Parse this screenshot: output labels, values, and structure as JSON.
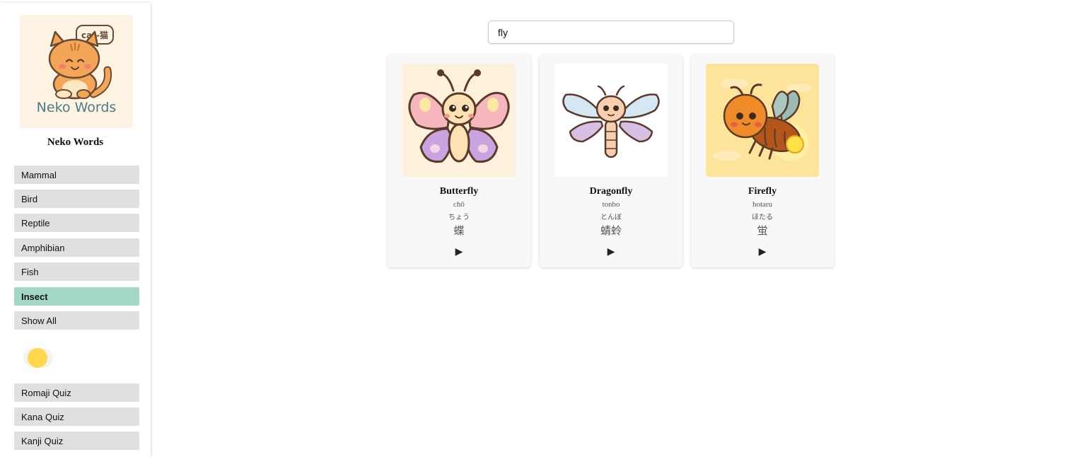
{
  "sidebar": {
    "logo": {
      "bubble_text": "cat-猫",
      "wordmark": "Neko Words",
      "icon": "cat-logo-icon"
    },
    "brand_title": "Neko Words",
    "categories": [
      {
        "label": "Mammal",
        "active": false
      },
      {
        "label": "Bird",
        "active": false
      },
      {
        "label": "Reptile",
        "active": false
      },
      {
        "label": "Amphibian",
        "active": false
      },
      {
        "label": "Fish",
        "active": false
      },
      {
        "label": "Insect",
        "active": true
      },
      {
        "label": "Show All",
        "active": false
      }
    ],
    "theme_toggle": {
      "icon": "sun-icon",
      "color": "#ffd84d"
    },
    "quizzes": [
      {
        "label": "Romaji Quiz"
      },
      {
        "label": "Kana Quiz"
      },
      {
        "label": "Kanji Quiz"
      }
    ],
    "active_color": "#a3d7c7"
  },
  "search": {
    "value": "fly"
  },
  "cards": [
    {
      "english": "Butterfly",
      "romaji": "chō",
      "kana": "ちょう",
      "kanji": "蝶",
      "icon": "butterfly-icon",
      "play_icon": "play-icon"
    },
    {
      "english": "Dragonfly",
      "romaji": "tonbo",
      "kana": "とんぼ",
      "kanji": "蜻蛉",
      "icon": "dragonfly-icon",
      "play_icon": "play-icon"
    },
    {
      "english": "Firefly",
      "romaji": "hotaru",
      "kana": "ほたる",
      "kanji": "蛍",
      "icon": "firefly-icon",
      "play_icon": "play-icon"
    }
  ]
}
